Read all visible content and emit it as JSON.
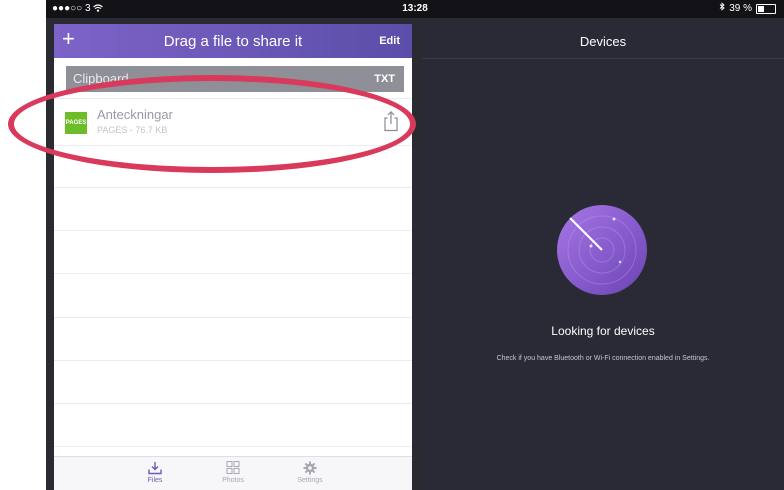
{
  "status_bar": {
    "carrier": "●●●○○ 3",
    "time": "13:28",
    "battery": "39 %",
    "battery_level": 0.39
  },
  "left_panel": {
    "title": "Drag a file to share it",
    "add_glyph": "+",
    "edit_label": "Edit",
    "clipboard": {
      "label": "Clipboard",
      "type": "TXT"
    },
    "files": [
      {
        "name": "Anteckningar",
        "meta": "PAGES - 76.7 KB",
        "icon_label": "PAGES",
        "icon_color": "#6dbd28"
      }
    ]
  },
  "tabs": [
    {
      "label": "Files",
      "icon": "download-tray-icon",
      "active": true
    },
    {
      "label": "Photos",
      "icon": "grid-icon",
      "active": false
    },
    {
      "label": "Settings",
      "icon": "gear-icon",
      "active": false
    }
  ],
  "right_panel": {
    "title": "Devices",
    "status": "Looking for devices",
    "hint": "Check if you have Bluetooth or Wi-Fi connection enabled in Settings."
  },
  "colors": {
    "accent": "#6b5bb8",
    "annotation": "#d9395a",
    "dark_bg": "#292a35"
  }
}
